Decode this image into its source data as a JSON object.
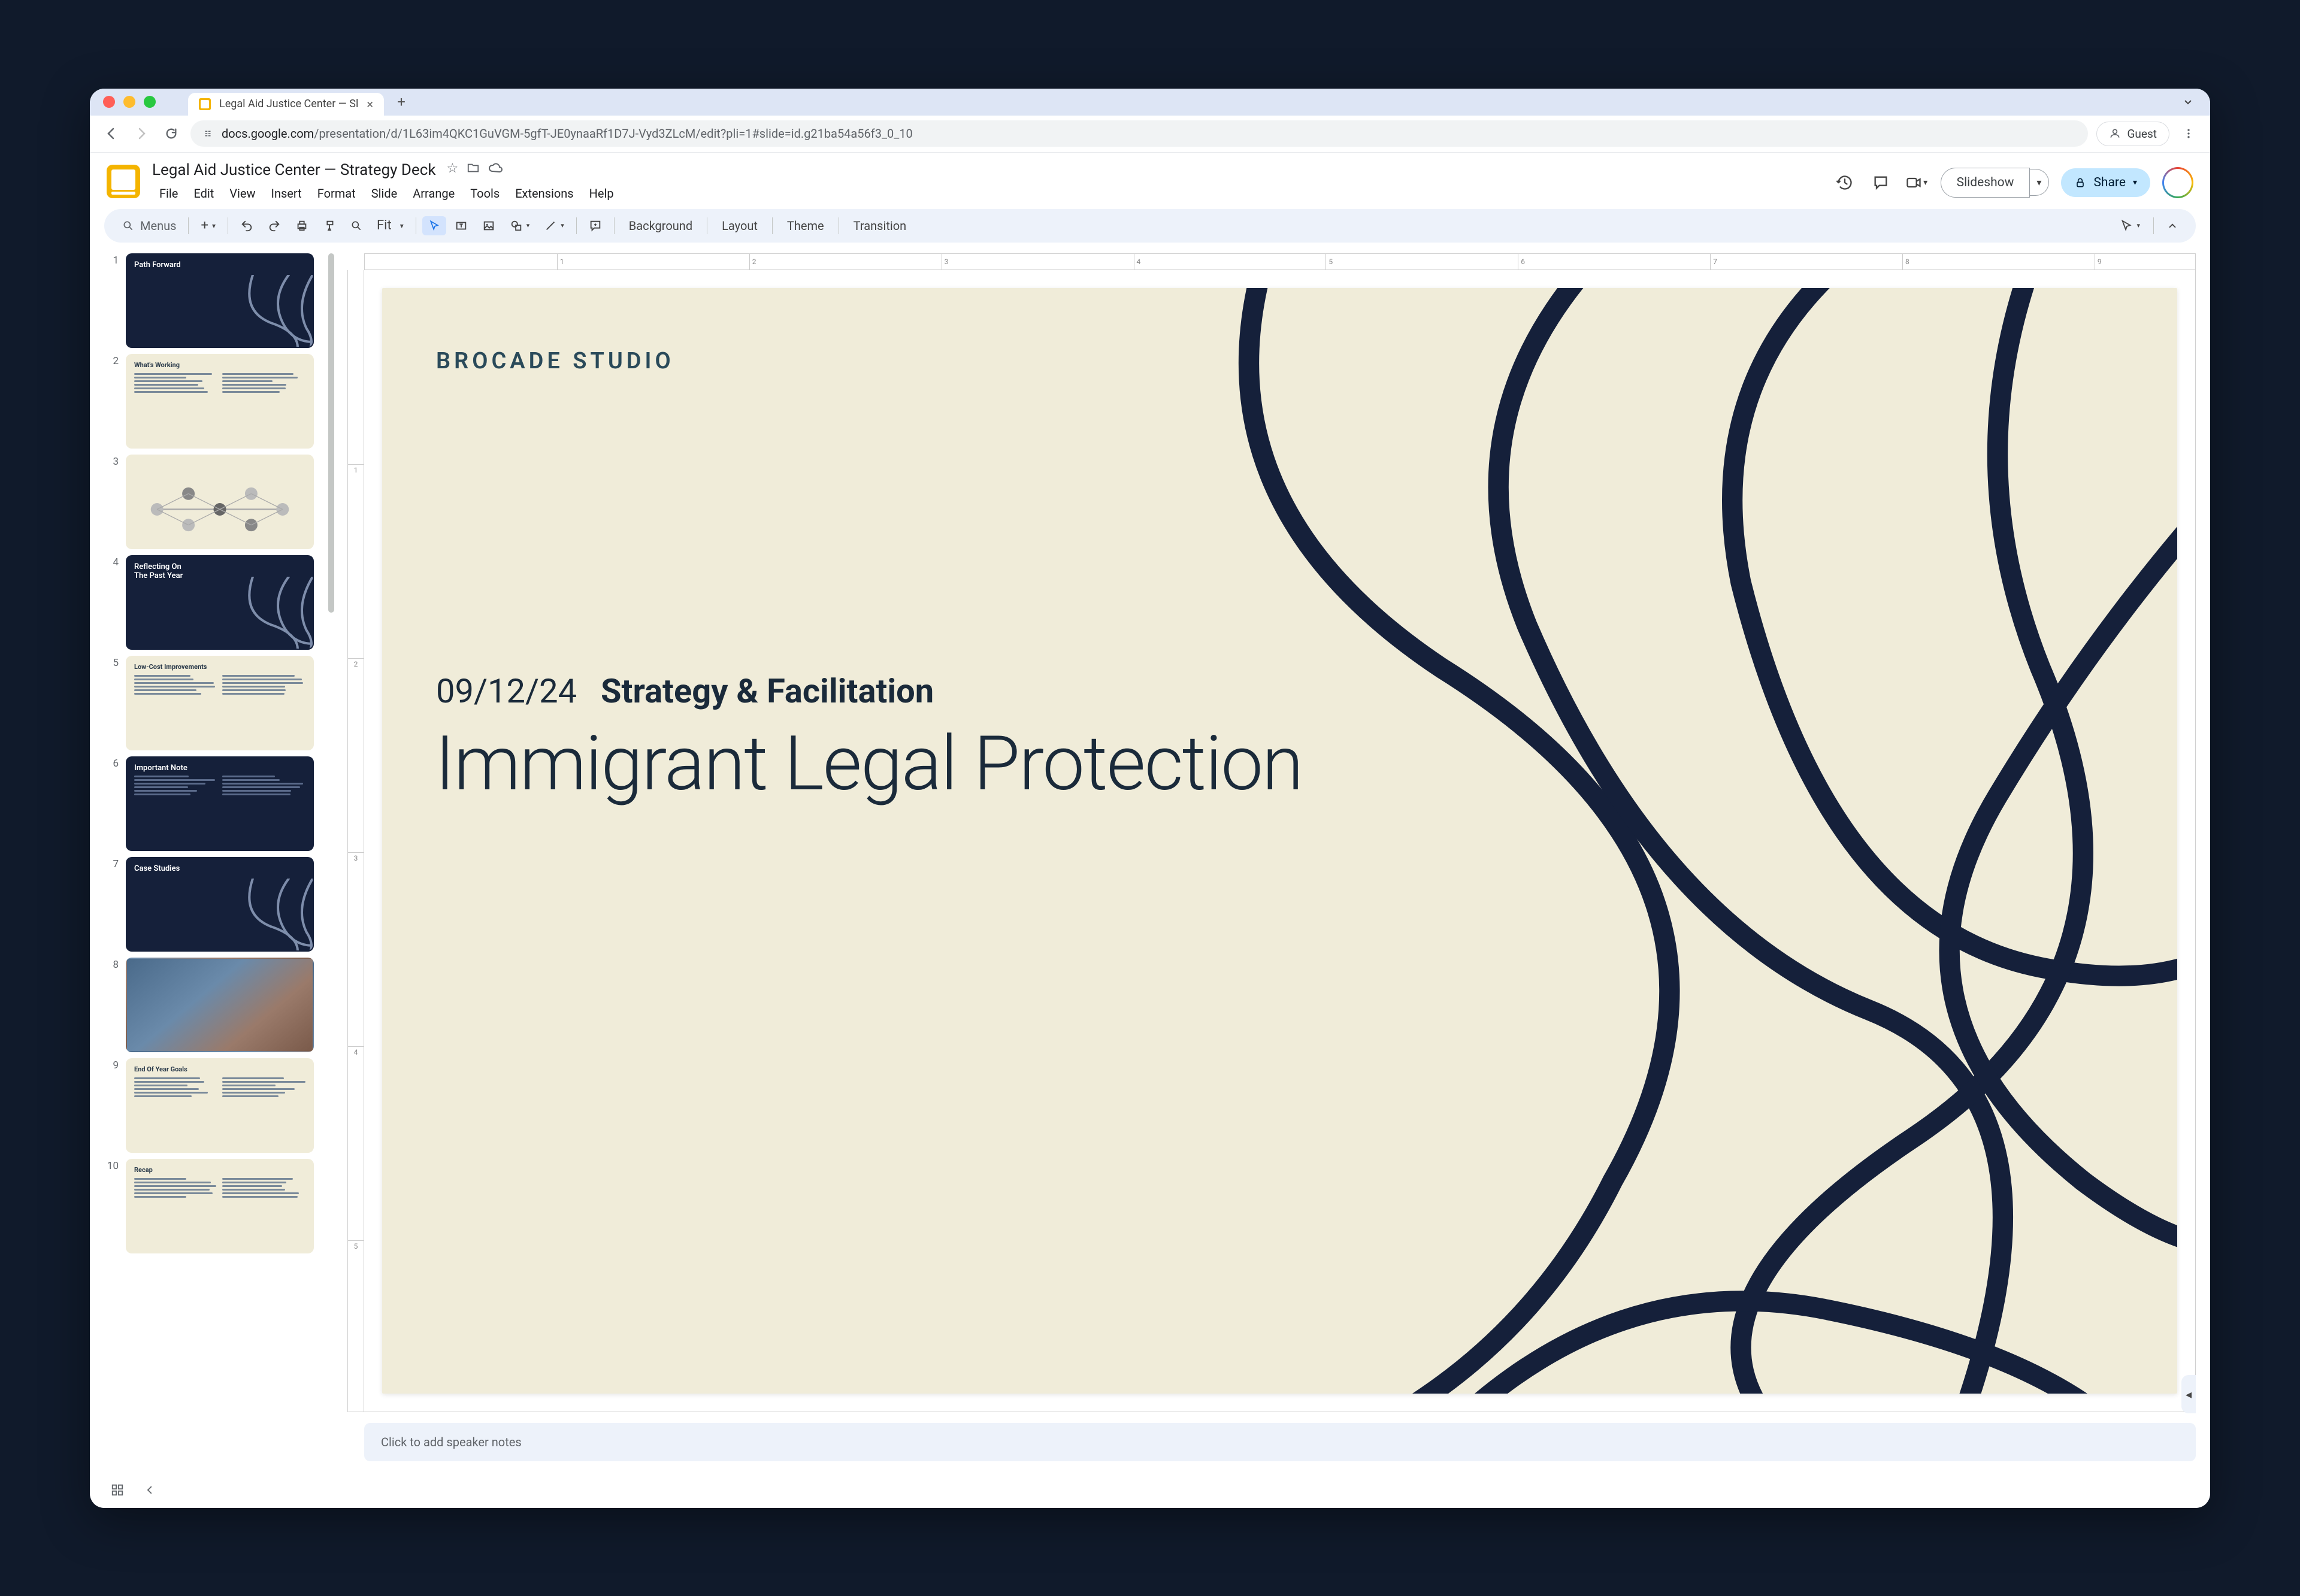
{
  "browser": {
    "tab_title": "Legal Aid Justice Center — Sl",
    "url_prefix": "docs.google.com",
    "url_path": "/presentation/d/1L63im4QKC1GuVGM-5gfT-JE0ynaaRf1D7J-Vyd3ZLcM/edit?pli=1#slide=id.g21ba54a56f3_0_10",
    "guest_label": "Guest"
  },
  "document": {
    "title": "Legal Aid Justice Center — Strategy Deck",
    "menus": [
      "File",
      "Edit",
      "View",
      "Insert",
      "Format",
      "Slide",
      "Arrange",
      "Tools",
      "Extensions",
      "Help"
    ]
  },
  "header_buttons": {
    "slideshow": "Slideshow",
    "share": "Share"
  },
  "toolbar": {
    "menus_label": "Menus",
    "zoom": "Fit",
    "background": "Background",
    "layout": "Layout",
    "theme": "Theme",
    "transition": "Transition"
  },
  "ruler_h": [
    "1",
    "2",
    "3",
    "4",
    "5",
    "6",
    "7",
    "8",
    "9"
  ],
  "ruler_v": [
    "1",
    "2",
    "3",
    "4",
    "5"
  ],
  "slide": {
    "brand": "BROCADE STUDIO",
    "date": "09/12/24",
    "subtitle": "Strategy & Facilitation",
    "title": "Immigrant Legal Protection"
  },
  "speaker_notes_placeholder": "Click to add speaker notes",
  "thumbnails": [
    {
      "num": "1",
      "style": "dark",
      "title": "Path Forward",
      "swirl": true
    },
    {
      "num": "2",
      "style": "light",
      "title": "What's Working",
      "text": true
    },
    {
      "num": "3",
      "style": "light",
      "title": "",
      "nodes": true
    },
    {
      "num": "4",
      "style": "dark",
      "title": "Reflecting On\nThe Past Year",
      "swirl": true
    },
    {
      "num": "5",
      "style": "light",
      "title": "Low-Cost Improvements",
      "text": true
    },
    {
      "num": "6",
      "style": "dark",
      "title": "Important Note",
      "text": true
    },
    {
      "num": "7",
      "style": "dark",
      "title": "Case Studies",
      "swirl": true
    },
    {
      "num": "8",
      "style": "photo",
      "title": ""
    },
    {
      "num": "9",
      "style": "light",
      "title": "End Of Year Goals",
      "text": true
    },
    {
      "num": "10",
      "style": "light",
      "title": "Recap",
      "text": true
    }
  ]
}
